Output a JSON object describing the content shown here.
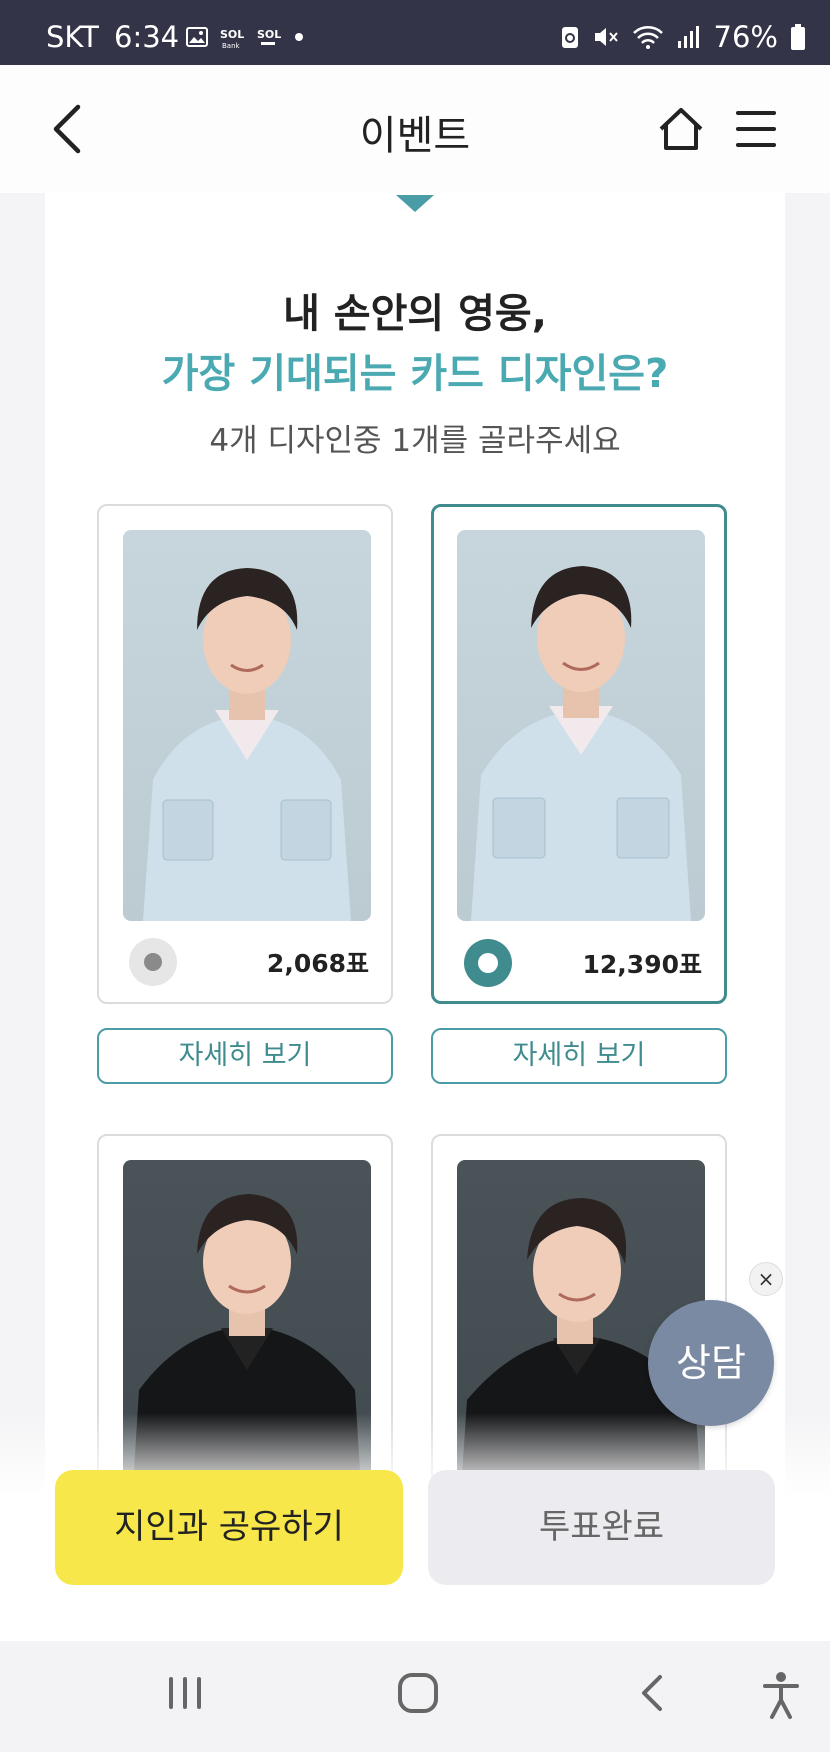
{
  "status_bar": {
    "carrier": "SKT",
    "time": "6:34",
    "battery": "76%"
  },
  "header": {
    "title": "이벤트"
  },
  "hero": {
    "line1": "내 손안의 영웅,",
    "line2": "가장 기대되는 카드 디자인은?",
    "subtitle": "4개 디자인중 1개를 골라주세요"
  },
  "cards": [
    {
      "votes": "2,068표",
      "selected": false,
      "detail_label": "자세히 보기"
    },
    {
      "votes": "12,390표",
      "selected": true,
      "detail_label": "자세히 보기"
    },
    {
      "selected": false
    },
    {
      "selected": false
    }
  ],
  "floating": {
    "chat_label": "상담",
    "close_symbol": "×"
  },
  "bottom": {
    "share_label": "지인과 공유하기",
    "vote_done_label": "투표완료"
  },
  "colors": {
    "accent": "#4aa9b1",
    "selected_border": "#3f8b8e",
    "share_bg": "#f8e74a",
    "chat_bg": "#7a8aa3",
    "status_bg": "#343448"
  }
}
